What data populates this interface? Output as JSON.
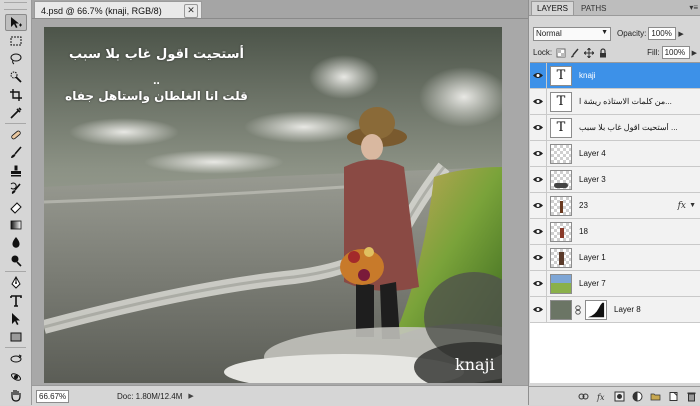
{
  "document": {
    "tab_title": "4.psd @ 66.7% (knaji, RGB/8)",
    "canvas_text_line1": "أستحيت اقول غاب بلا سبب",
    "canvas_text_dots": "..",
    "canvas_text_line2": "قلت انا الغلطان واستاهل جفاه",
    "signature": "knaji"
  },
  "status": {
    "zoom": "66.67%",
    "doc_info": "Doc: 1.80M/12.4M"
  },
  "panel": {
    "tabs": [
      "LAYERS",
      "PATHS"
    ],
    "blend_mode": "Normal",
    "opacity_label": "Opacity:",
    "opacity_value": "100%",
    "lock_label": "Lock:",
    "fill_label": "Fill:",
    "fill_value": "100%"
  },
  "layers": [
    {
      "name": "knaji",
      "type": "text",
      "selected": true
    },
    {
      "name": "من كلمات الاستاذه ريشة ا...",
      "type": "text"
    },
    {
      "name": "أستحيت اقول غاب بلا سبب ...",
      "type": "text"
    },
    {
      "name": "Layer 4",
      "type": "pixel"
    },
    {
      "name": "Layer 3",
      "type": "pixel"
    },
    {
      "name": "23",
      "type": "pixel",
      "fx": "fx"
    },
    {
      "name": "18",
      "type": "pixel"
    },
    {
      "name": "Layer 1",
      "type": "pixel"
    },
    {
      "name": "Layer 7",
      "type": "pixel"
    },
    {
      "name": "Layer 8",
      "type": "mask"
    }
  ],
  "colors": {
    "selected_layer": "#3d91e8",
    "canvas_sky": "#6f7568",
    "grass_green": "#5a8a2a"
  }
}
